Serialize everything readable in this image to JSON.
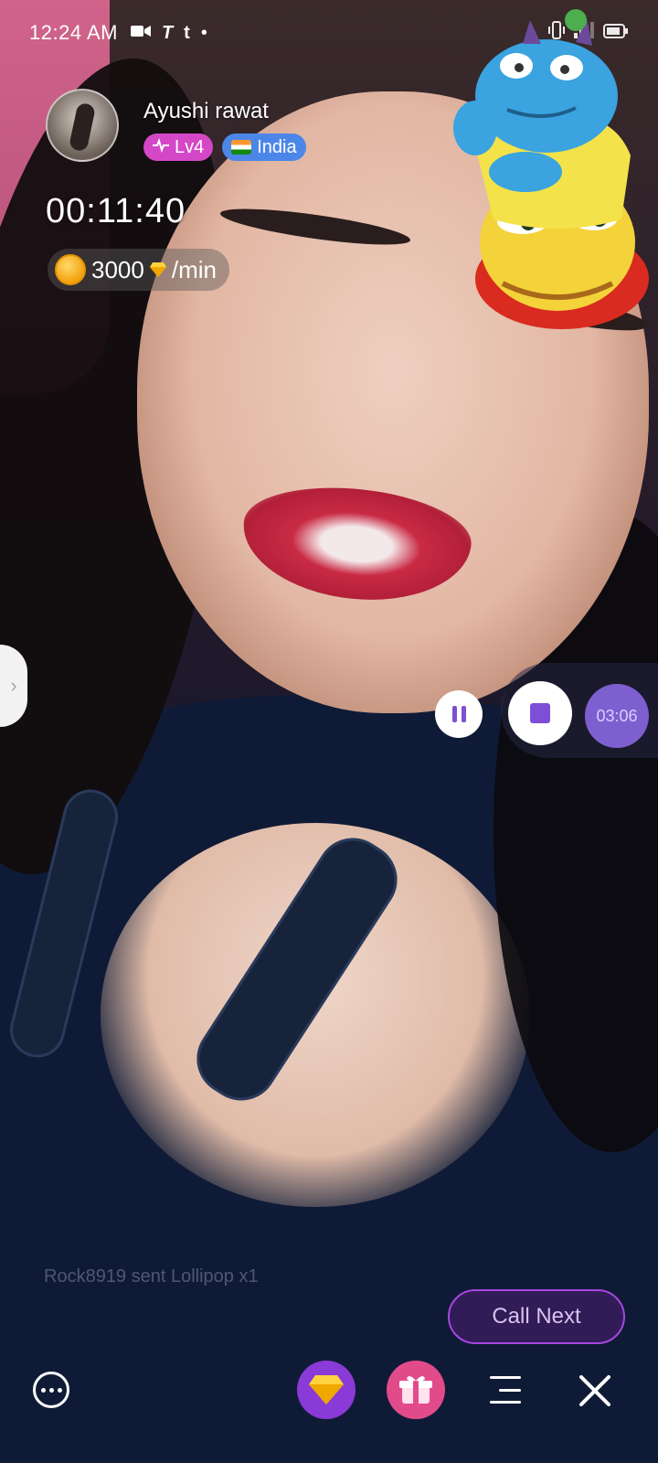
{
  "status_bar": {
    "time": "12:24 AM",
    "left_icons": [
      "video-camera-icon",
      "text-t-icon",
      "tumblr-t-icon",
      "dot-icon"
    ],
    "right_icons": [
      "vibrate-icon",
      "signal-icon",
      "battery-icon"
    ]
  },
  "host": {
    "name": "Ayushi rawat",
    "level_label": "Lv4",
    "country_label": "India",
    "call_timer": "00:11:40",
    "rate_value": "3000",
    "rate_unit": "/min"
  },
  "recording": {
    "elapsed": "03:06"
  },
  "gift_message": "Rock8919 sent Lollipop x1",
  "call_next_label": "Call Next",
  "toolbar": {
    "items": [
      "chat-icon",
      "diamond-icon",
      "gift-icon",
      "menu-icon",
      "close-icon"
    ]
  },
  "colors": {
    "accent_purple": "#7e4fd6",
    "level_badge": "#d448c7",
    "country_badge": "#4c86e8",
    "gift_button": "#e24b8a",
    "diamond_button": "#8a3ad6",
    "call_next_border": "#a746e0"
  }
}
